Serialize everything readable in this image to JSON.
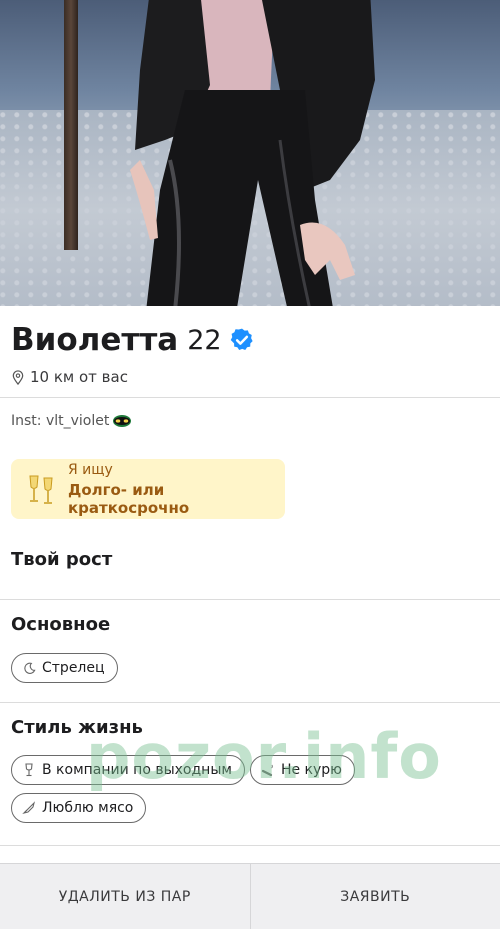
{
  "profile": {
    "name": "Виолетта",
    "age": "22",
    "distance": "10 км от вас",
    "bio": "Inst: vlt_violet"
  },
  "looking_for": {
    "label": "Я ищу",
    "value": "Долго- или краткосрочно",
    "icon": "champagne-glasses-icon"
  },
  "sections": {
    "height_title": "Твой рост",
    "basic_title": "Основное",
    "basic_chips": [
      {
        "label": "Стрелец",
        "icon": "moon-icon"
      }
    ],
    "lifestyle_title": "Стиль жизнь",
    "lifestyle_chips": [
      {
        "label": "В компании по выходным",
        "icon": "wine-glass-icon"
      },
      {
        "label": "Не курю",
        "icon": "cigarette-icon"
      },
      {
        "label": "Люблю мясо",
        "icon": "utensils-icon"
      }
    ]
  },
  "watermark": "pozor.info",
  "actions": {
    "remove_label": "УДАЛИТЬ ИЗ ПАР",
    "report_label": "ЗАЯВИТЬ"
  },
  "colors": {
    "verified": "#1e90ff",
    "looking_bg": "#fff5c9",
    "looking_text": "#9a5b12"
  }
}
